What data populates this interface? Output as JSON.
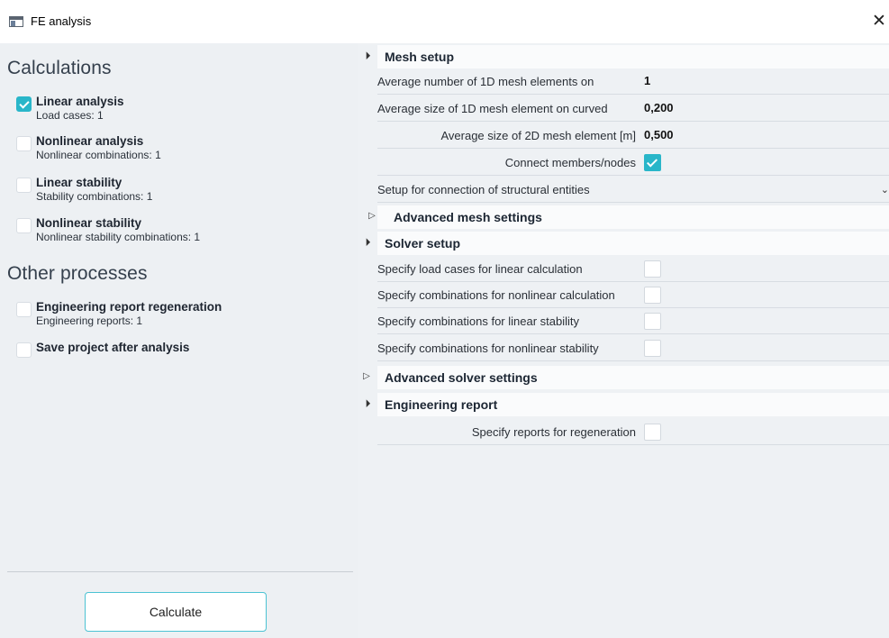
{
  "window": {
    "title": "FE analysis",
    "close_symbol": "✕",
    "icon": "app-window-icon"
  },
  "left": {
    "calculations_heading": "Calculations",
    "options": [
      {
        "title": "Linear analysis",
        "sub": "Load cases: 1",
        "checked": true
      },
      {
        "title": "Nonlinear analysis",
        "sub": "Nonlinear combinations: 1",
        "checked": false
      },
      {
        "title": "Linear stability",
        "sub": "Stability combinations: 1",
        "checked": false
      },
      {
        "title": "Nonlinear stability",
        "sub": "Nonlinear stability combinations: 1",
        "checked": false
      }
    ],
    "other_heading": "Other processes",
    "other_options": [
      {
        "title": "Engineering report regeneration",
        "sub": "Engineering reports: 1",
        "checked": false
      },
      {
        "title": "Save project after analysis",
        "sub": "",
        "checked": false
      }
    ],
    "calculate_label": "Calculate"
  },
  "right": {
    "mesh": {
      "label": "Mesh setup",
      "toggle": "◢",
      "rows": [
        {
          "label": "Average number of 1D mesh elements on",
          "value": "1"
        },
        {
          "label": "Average size of 1D mesh element on curved",
          "value": "0,200"
        },
        {
          "label": "Average size of 2D mesh element [m]",
          "value": "0,500"
        },
        {
          "label": "Connect members/nodes",
          "checked": true
        },
        {
          "label": "Setup for connection of structural entities",
          "value": ""
        }
      ]
    },
    "advanced_mesh": {
      "label": "Advanced mesh settings",
      "toggle": "▷"
    },
    "solver": {
      "label": "Solver setup",
      "toggle": "◢",
      "rows": [
        {
          "label": "Specify load cases for linear calculation",
          "checked": false
        },
        {
          "label": "Specify combinations for nonlinear calculation",
          "checked": false
        },
        {
          "label": "Specify combinations for linear stability",
          "checked": false
        },
        {
          "label": "Specify combinations for nonlinear stability",
          "checked": false
        }
      ]
    },
    "advanced_solver": {
      "label": "Advanced solver settings",
      "toggle": "▷"
    },
    "report": {
      "label": "Engineering report",
      "toggle": "◢",
      "rows": [
        {
          "label": "Specify reports for regeneration",
          "checked": false
        }
      ]
    }
  },
  "colors": {
    "accent": "#29b6c9",
    "left_bg": "#edf0f3",
    "right_bg": "#eef1f4",
    "button_border": "#4cc3d3"
  }
}
